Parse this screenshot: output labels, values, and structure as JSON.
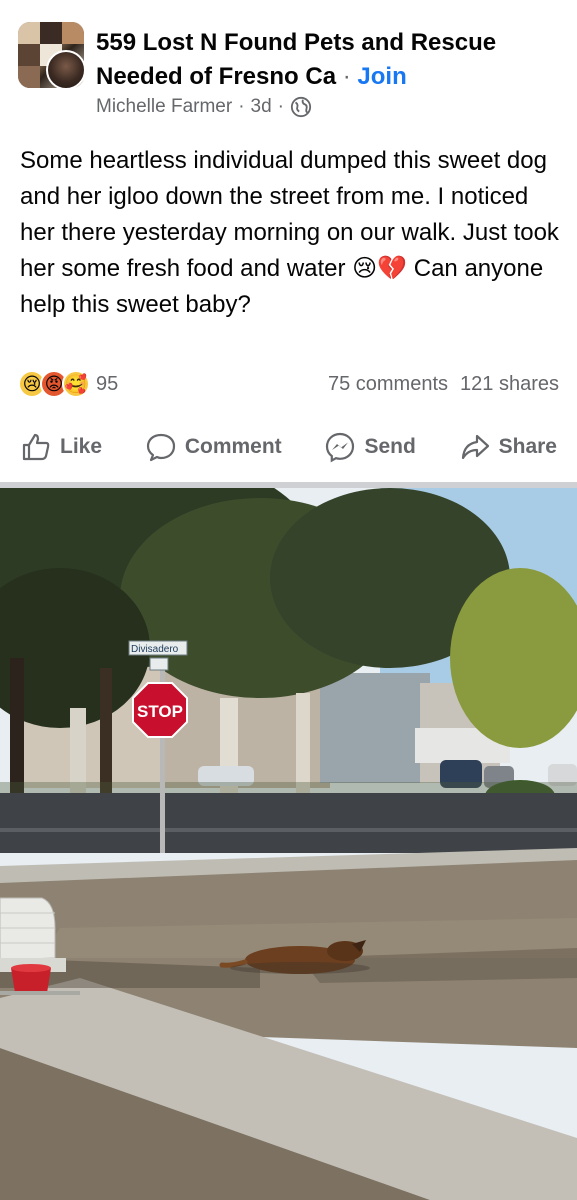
{
  "group": {
    "name": "559 Lost N Found Pets and Rescue Needed of Fresno Ca",
    "separator": "·",
    "join_label": "Join"
  },
  "author": {
    "name": "Michelle Farmer",
    "time": "3d",
    "separator": "·",
    "privacy_icon": "globe-icon"
  },
  "post": {
    "text": "Some heartless individual dumped this sweet dog and her igloo down the street from me. I noticed her there yesterday morning on our walk. Just took her some fresh food and water 😢💔 Can anyone help this sweet baby?"
  },
  "reactions": {
    "icons": [
      "😢",
      "😡",
      "🥰"
    ],
    "count": "95",
    "comments": "75 comments",
    "shares": "121 shares"
  },
  "actions": {
    "like": "Like",
    "comment": "Comment",
    "send": "Send",
    "share": "Share"
  },
  "photo": {
    "street_sign": "Divisadero",
    "stop_sign": "STOP"
  },
  "colors": {
    "link": "#1877f2",
    "secondary_text": "#65676b",
    "divider": "#ced0d4"
  }
}
